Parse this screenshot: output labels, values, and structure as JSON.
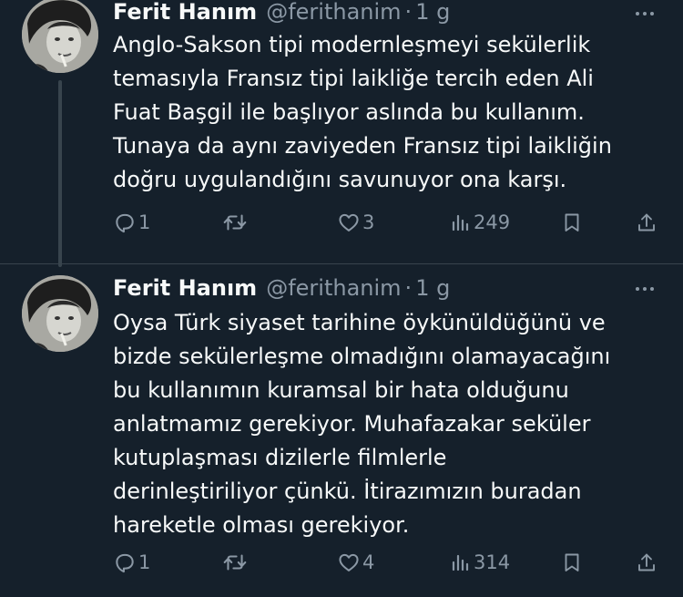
{
  "tweets": [
    {
      "author_name": "Ferit Hanım",
      "handle": "@ferithanim",
      "separator": "·",
      "time": "1 g",
      "lines": [
        "Anglo-Sakson tipi modernleşmeyi sekülerlik",
        "temasıyla Fransız tipi laikliğe tercih eden Ali",
        "Fuat Başgil ile başlıyor aslında bu kullanım.",
        "Tunaya da aynı zaviyeden Fransız tipi laikliğin",
        "doğru uygulandığını savunuyor ona karşı."
      ],
      "replies": "1",
      "likes": "3",
      "views": "249"
    },
    {
      "author_name": "Ferit Hanım",
      "handle": "@ferithanim",
      "separator": "·",
      "time": "1 g",
      "lines": [
        "Oysa Türk siyaset tarihine öykünüldüğünü ve",
        "bizde sekülerleşme olmadığını olamayacağını",
        "bu kullanımın kuramsal bir hata olduğunu",
        "anlatmamız gerekiyor. Muhafazakar seküler",
        "kutuplaşması dizilerle filmlerle",
        "derinleştiriliyor çünkü. İtirazımızın buradan",
        "hareketle olması gerekiyor."
      ],
      "replies": "1",
      "likes": "4",
      "views": "314"
    }
  ],
  "theme": {
    "background": "#15202b",
    "text": "#f7f9f9",
    "muted": "#8b98a5",
    "border": "#38444d"
  },
  "icons": [
    "avatar",
    "more-icon",
    "reply-icon",
    "retweet-icon",
    "like-icon",
    "views-icon",
    "bookmark-icon",
    "share-icon"
  ]
}
